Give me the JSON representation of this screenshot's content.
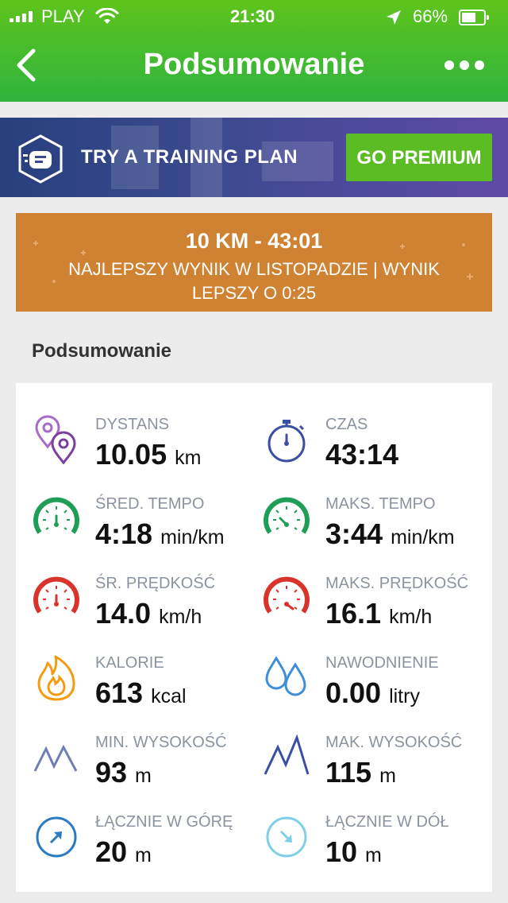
{
  "status_bar": {
    "carrier": "PLAY",
    "time": "21:30",
    "battery": "66%"
  },
  "nav": {
    "title": "Podsumowanie"
  },
  "promo": {
    "text": "TRY A TRAINING PLAN",
    "button": "GO PREMIUM"
  },
  "record": {
    "headline": "10 KM - 43:01",
    "detail": "NAJLEPSZY WYNIK W LISTOPADZIE  |  WYNIK LEPSZY O 0:25"
  },
  "summary": {
    "title": "Podsumowanie",
    "stats": [
      {
        "label": "DYSTANS",
        "value": "10.05",
        "unit": "km",
        "icon": "location-pins-icon",
        "color": "#8e44ad"
      },
      {
        "label": "CZAS",
        "value": "43:14",
        "unit": "",
        "icon": "stopwatch-icon",
        "color": "#3b4fa3"
      },
      {
        "label": "ŚRED. TEMPO",
        "value": "4:18",
        "unit": "min/km",
        "icon": "gauge-avg-pace-icon",
        "color": "#1e9e57"
      },
      {
        "label": "MAKS. TEMPO",
        "value": "3:44",
        "unit": "min/km",
        "icon": "gauge-max-pace-icon",
        "color": "#1e9e57"
      },
      {
        "label": "ŚR. PRĘDKOŚĆ",
        "value": "14.0",
        "unit": "km/h",
        "icon": "gauge-avg-speed-icon",
        "color": "#d9342b"
      },
      {
        "label": "MAKS. PRĘDKOŚĆ",
        "value": "16.1",
        "unit": "km/h",
        "icon": "gauge-max-speed-icon",
        "color": "#d9342b"
      },
      {
        "label": "KALORIE",
        "value": "613",
        "unit": "kcal",
        "icon": "flame-icon",
        "color": "#f39c12"
      },
      {
        "label": "NAWODNIENIE",
        "value": "0.00",
        "unit": "litry",
        "icon": "water-drops-icon",
        "color": "#3f8fd8"
      },
      {
        "label": "MIN. WYSOKOŚĆ",
        "value": "93",
        "unit": "m",
        "icon": "mountains-low-icon",
        "color": "#6f7fb3"
      },
      {
        "label": "MAK. WYSOKOŚĆ",
        "value": "115",
        "unit": "m",
        "icon": "mountains-high-icon",
        "color": "#3b4fa3"
      },
      {
        "label": "ŁĄCZNIE W GÓRĘ",
        "value": "20",
        "unit": "m",
        "icon": "arrow-up-circle-icon",
        "color": "#2a7bbf"
      },
      {
        "label": "ŁĄCZNIE W DÓŁ",
        "value": "10",
        "unit": "m",
        "icon": "arrow-down-circle-icon",
        "color": "#7fd0e6"
      }
    ]
  }
}
